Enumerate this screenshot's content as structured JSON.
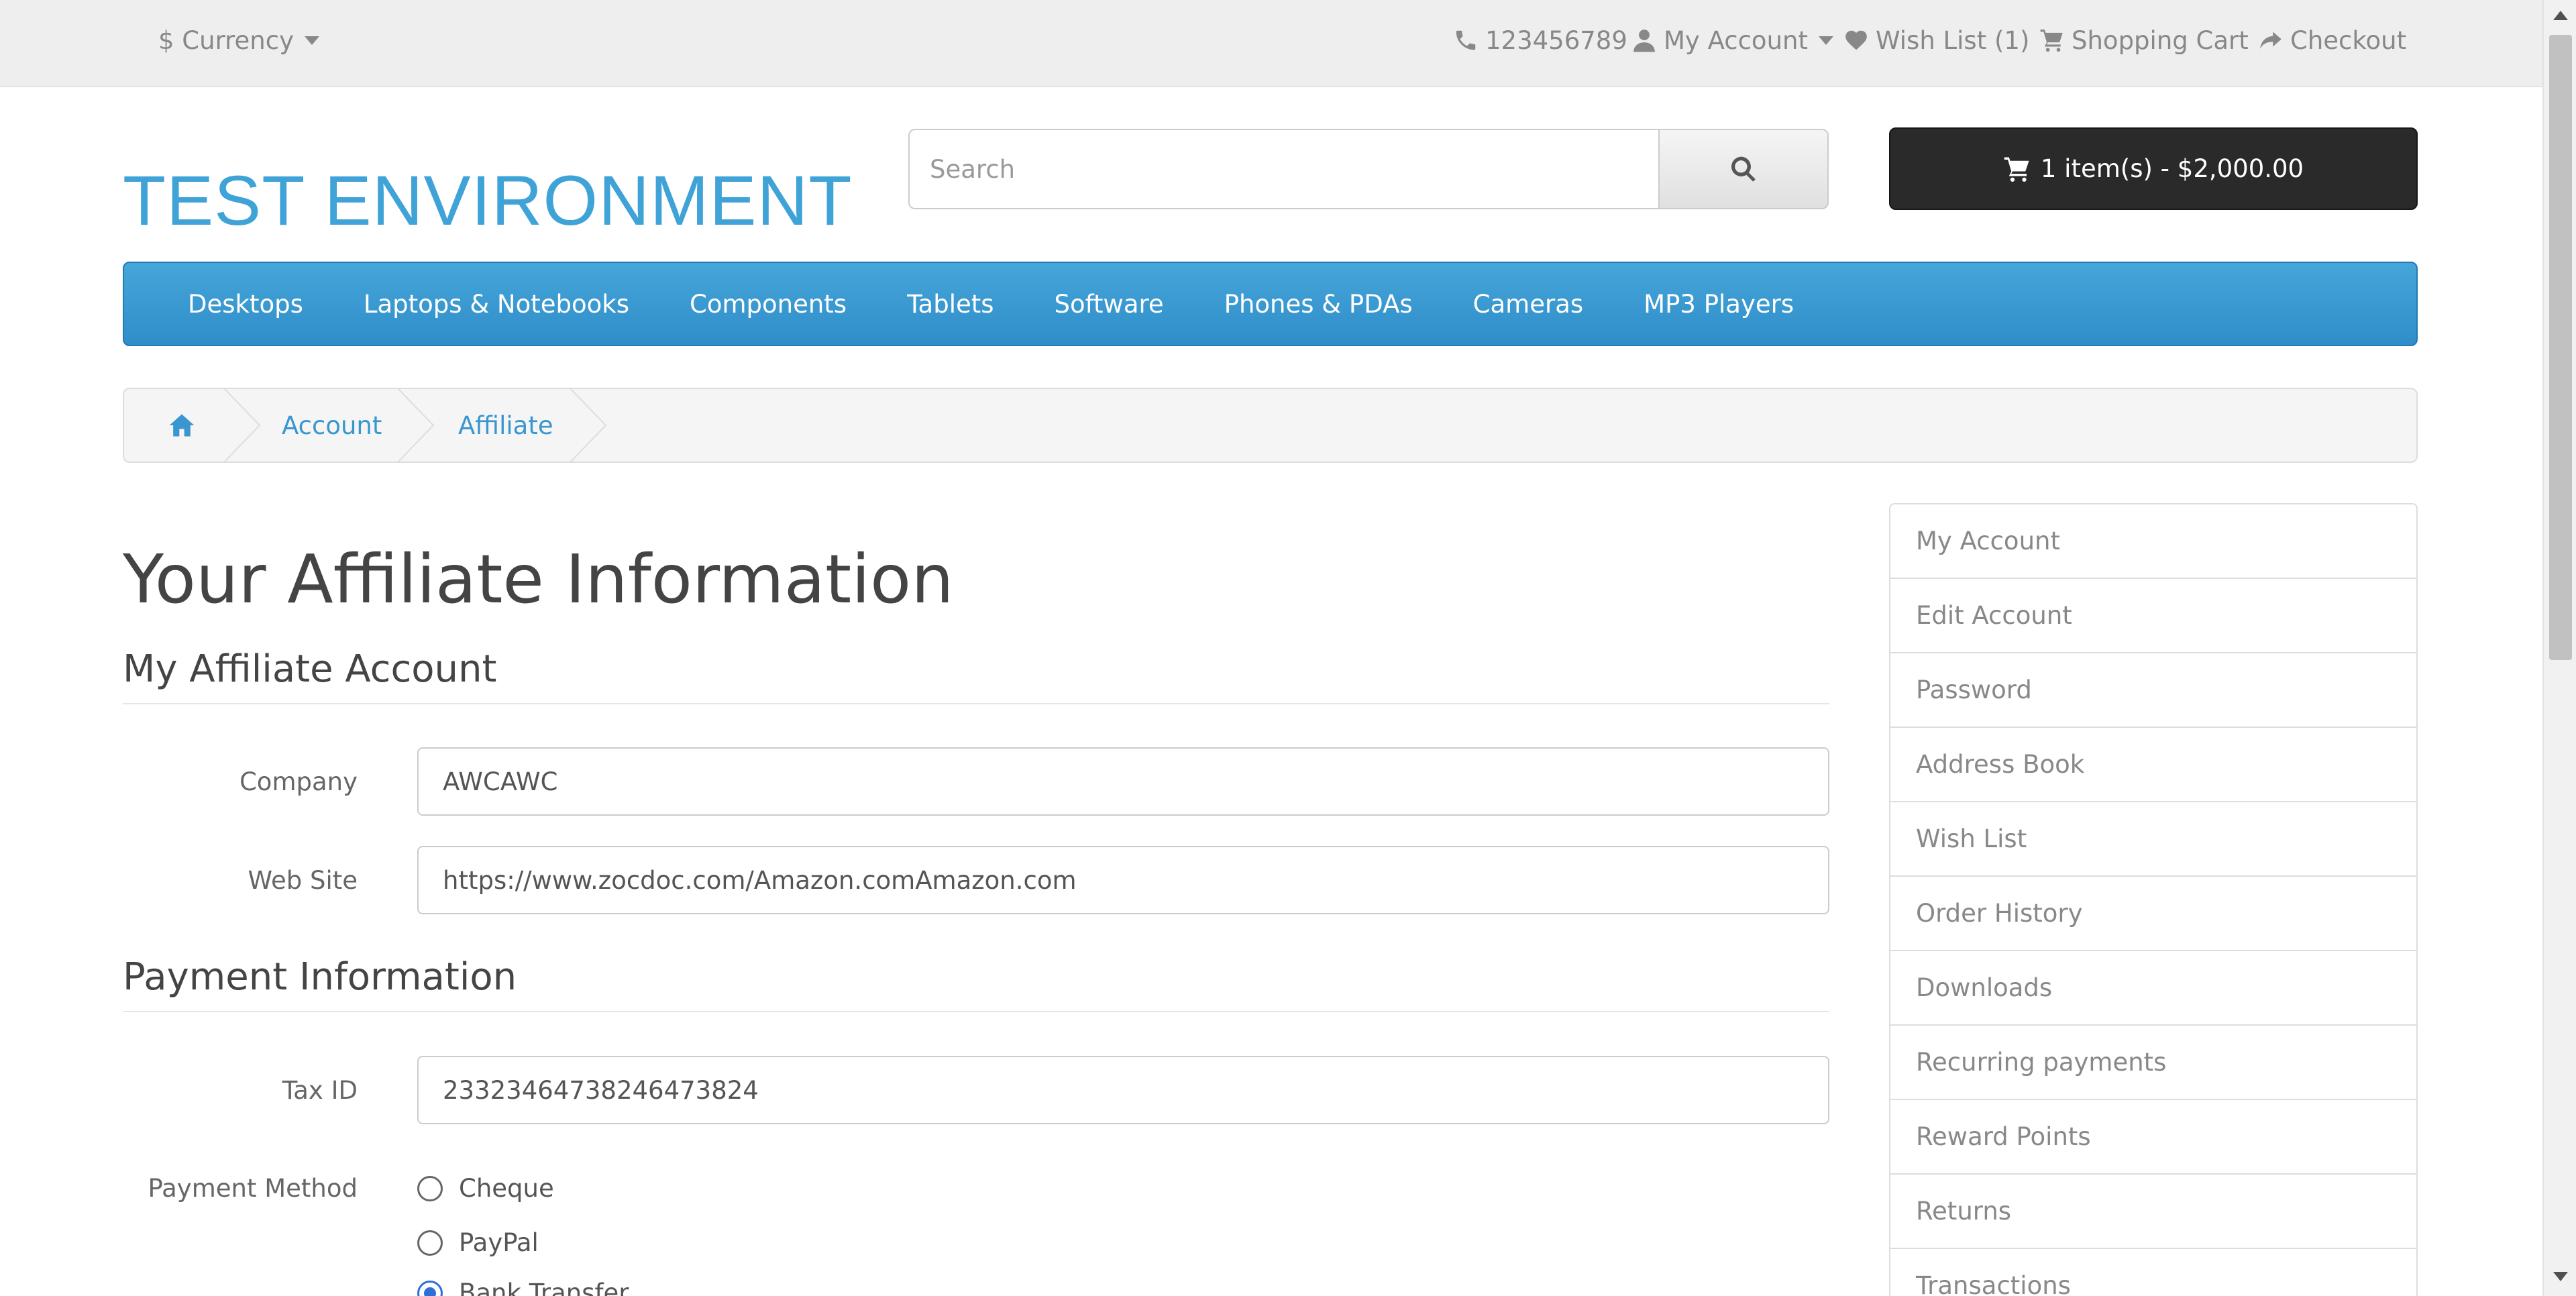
{
  "topbar": {
    "currency": "$ Currency",
    "phone": "123456789",
    "my_account": "My Account",
    "wish_list": "Wish List (1)",
    "shopping_cart": "Shopping Cart",
    "checkout": "Checkout"
  },
  "header": {
    "logo": "TEST ENVIRONMENT",
    "search_placeholder": "Search",
    "cart_button": "1 item(s) - $2,000.00"
  },
  "menu": [
    "Desktops",
    "Laptops & Notebooks",
    "Components",
    "Tablets",
    "Software",
    "Phones & PDAs",
    "Cameras",
    "MP3 Players"
  ],
  "breadcrumb": [
    "Account",
    "Affiliate"
  ],
  "page_title": "Your Affiliate Information",
  "section_account": {
    "legend": "My Affiliate Account",
    "company_label": "Company",
    "company_value": "AWCAWC",
    "website_label": "Web Site",
    "website_value": "https://www.zocdoc.com/Amazon.comAmazon.com"
  },
  "section_payment": {
    "legend": "Payment Information",
    "tax_label": "Tax ID",
    "tax_value": "23323464738246473824",
    "method_label": "Payment Method",
    "methods": [
      {
        "label": "Cheque",
        "checked": false
      },
      {
        "label": "PayPal",
        "checked": false
      },
      {
        "label": "Bank Transfer",
        "checked": true
      }
    ]
  },
  "sidebar": [
    "My Account",
    "Edit Account",
    "Password",
    "Address Book",
    "Wish List",
    "Order History",
    "Downloads",
    "Recurring payments",
    "Reward Points",
    "Returns",
    "Transactions"
  ],
  "colors": {
    "accent": "#3fa3d8",
    "menu_bg": "#2f8dc9",
    "cart_bg": "#2a2a2a"
  }
}
